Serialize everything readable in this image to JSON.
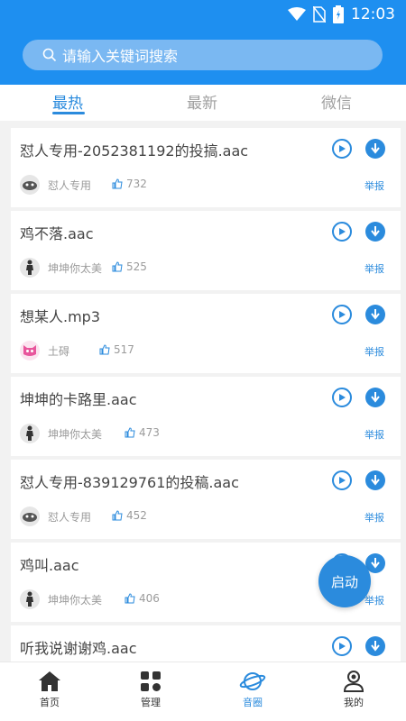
{
  "status": {
    "time": "12:03"
  },
  "search": {
    "placeholder": "请输入关键词搜索"
  },
  "tabs": [
    {
      "label": "最热",
      "active": true
    },
    {
      "label": "最新",
      "active": false
    },
    {
      "label": "微信",
      "active": false
    }
  ],
  "items": [
    {
      "title": "怼人专用-2052381192的投搞.aac",
      "author": "怼人专用",
      "likes": "732",
      "report": "举报",
      "avatar": "cat-avatar-icon"
    },
    {
      "title": "鸡不落.aac",
      "author": "坤坤你太美",
      "likes": "525",
      "report": "举报",
      "avatar": "figure-avatar-icon"
    },
    {
      "title": "想某人.mp3",
      "author": "土碍",
      "likes": "517",
      "report": "举报",
      "avatar": "pink-monster-avatar-icon"
    },
    {
      "title": "坤坤的卡路里.aac",
      "author": "坤坤你太美",
      "likes": "473",
      "report": "举报",
      "avatar": "figure-avatar-icon"
    },
    {
      "title": "怼人专用-839129761的投稿.aac",
      "author": "怼人专用",
      "likes": "452",
      "report": "举报",
      "avatar": "cat-avatar-icon"
    },
    {
      "title": "鸡叫.aac",
      "author": "坤坤你太美",
      "likes": "406",
      "report": "举报",
      "avatar": "figure-avatar-icon"
    },
    {
      "title": "听我说谢谢鸡.aac",
      "author": "",
      "likes": "",
      "report": "",
      "avatar": ""
    }
  ],
  "fab": {
    "label": "启动"
  },
  "nav": [
    {
      "label": "首页",
      "icon": "home-icon",
      "active": false
    },
    {
      "label": "管理",
      "icon": "grid-icon",
      "active": false
    },
    {
      "label": "音圈",
      "icon": "planet-icon",
      "active": true
    },
    {
      "label": "我的",
      "icon": "user-icon",
      "active": false
    }
  ],
  "colors": {
    "primary": "#1e8ff0",
    "accent": "#2b8bdd"
  }
}
